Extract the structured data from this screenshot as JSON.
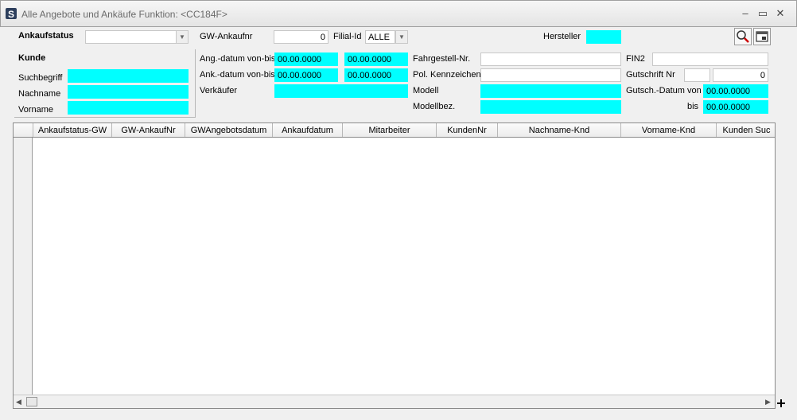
{
  "window": {
    "title": "Alle Angebote und Ankäufe   Funktion: <CC184F>",
    "minimize_glyph": "–",
    "maximize_glyph": "▭",
    "close_glyph": "✕"
  },
  "filters": {
    "ankaufstatus_label": "Ankaufstatus",
    "ankaufstatus_value": "",
    "gw_ankaufnr_label": "GW-Ankaufnr",
    "gw_ankaufnr_value": "0",
    "filial_id_label": "Filial-Id",
    "filial_id_value": "ALLE",
    "hersteller_label": "Hersteller",
    "hersteller_value": "",
    "kunde_group_label": "Kunde",
    "suchbegriff_label": "Suchbegriff",
    "suchbegriff_value": "",
    "nachname_label": "Nachname",
    "nachname_value": "",
    "vorname_label": "Vorname",
    "vorname_value": "",
    "ang_datum_label": "Ang.-datum von-bis",
    "ang_datum_from": "00.00.0000",
    "ang_datum_to": "00.00.0000",
    "ank_datum_label": "Ank.-datum von-bis",
    "ank_datum_from": "00.00.0000",
    "ank_datum_to": "00.00.0000",
    "verkaeufer_label": "Verkäufer",
    "verkaeufer_value": "",
    "fahrgestell_label": "Fahrgestell-Nr.",
    "fahrgestell_value": "",
    "kennzeichen_label": "Pol. Kennzeichen",
    "kennzeichen_value": "",
    "modell_label": "Modell",
    "modell_value": "",
    "modellbez_label": "Modellbez.",
    "modellbez_value": "",
    "fin2_label": "FIN2",
    "fin2_value": "",
    "gutschrift_label": "Gutschrift Nr",
    "gutschrift_prefix": "",
    "gutschrift_value": "0",
    "gutsch_datum_label": "Gutsch.-Datum von",
    "gutsch_datum_from": "00.00.0000",
    "bis_label": "bis",
    "gutsch_datum_to": "00.00.0000"
  },
  "grid": {
    "columns": [
      "Ankaufstatus-GW",
      "GW-AnkaufNr",
      "GWAngebotsdatum",
      "Ankaufdatum",
      "Mitarbeiter",
      "KundenNr",
      "Nachname-Knd",
      "Vorname-Knd",
      "Kunden Suc"
    ],
    "rows": []
  },
  "icons": {
    "app": "app-logo-icon",
    "search": "magnifier-icon",
    "export": "export-window-icon",
    "combo": "chevron-down-icon"
  },
  "colors": {
    "required_field": "#00ffff",
    "title_text": "#6a6a6a"
  }
}
